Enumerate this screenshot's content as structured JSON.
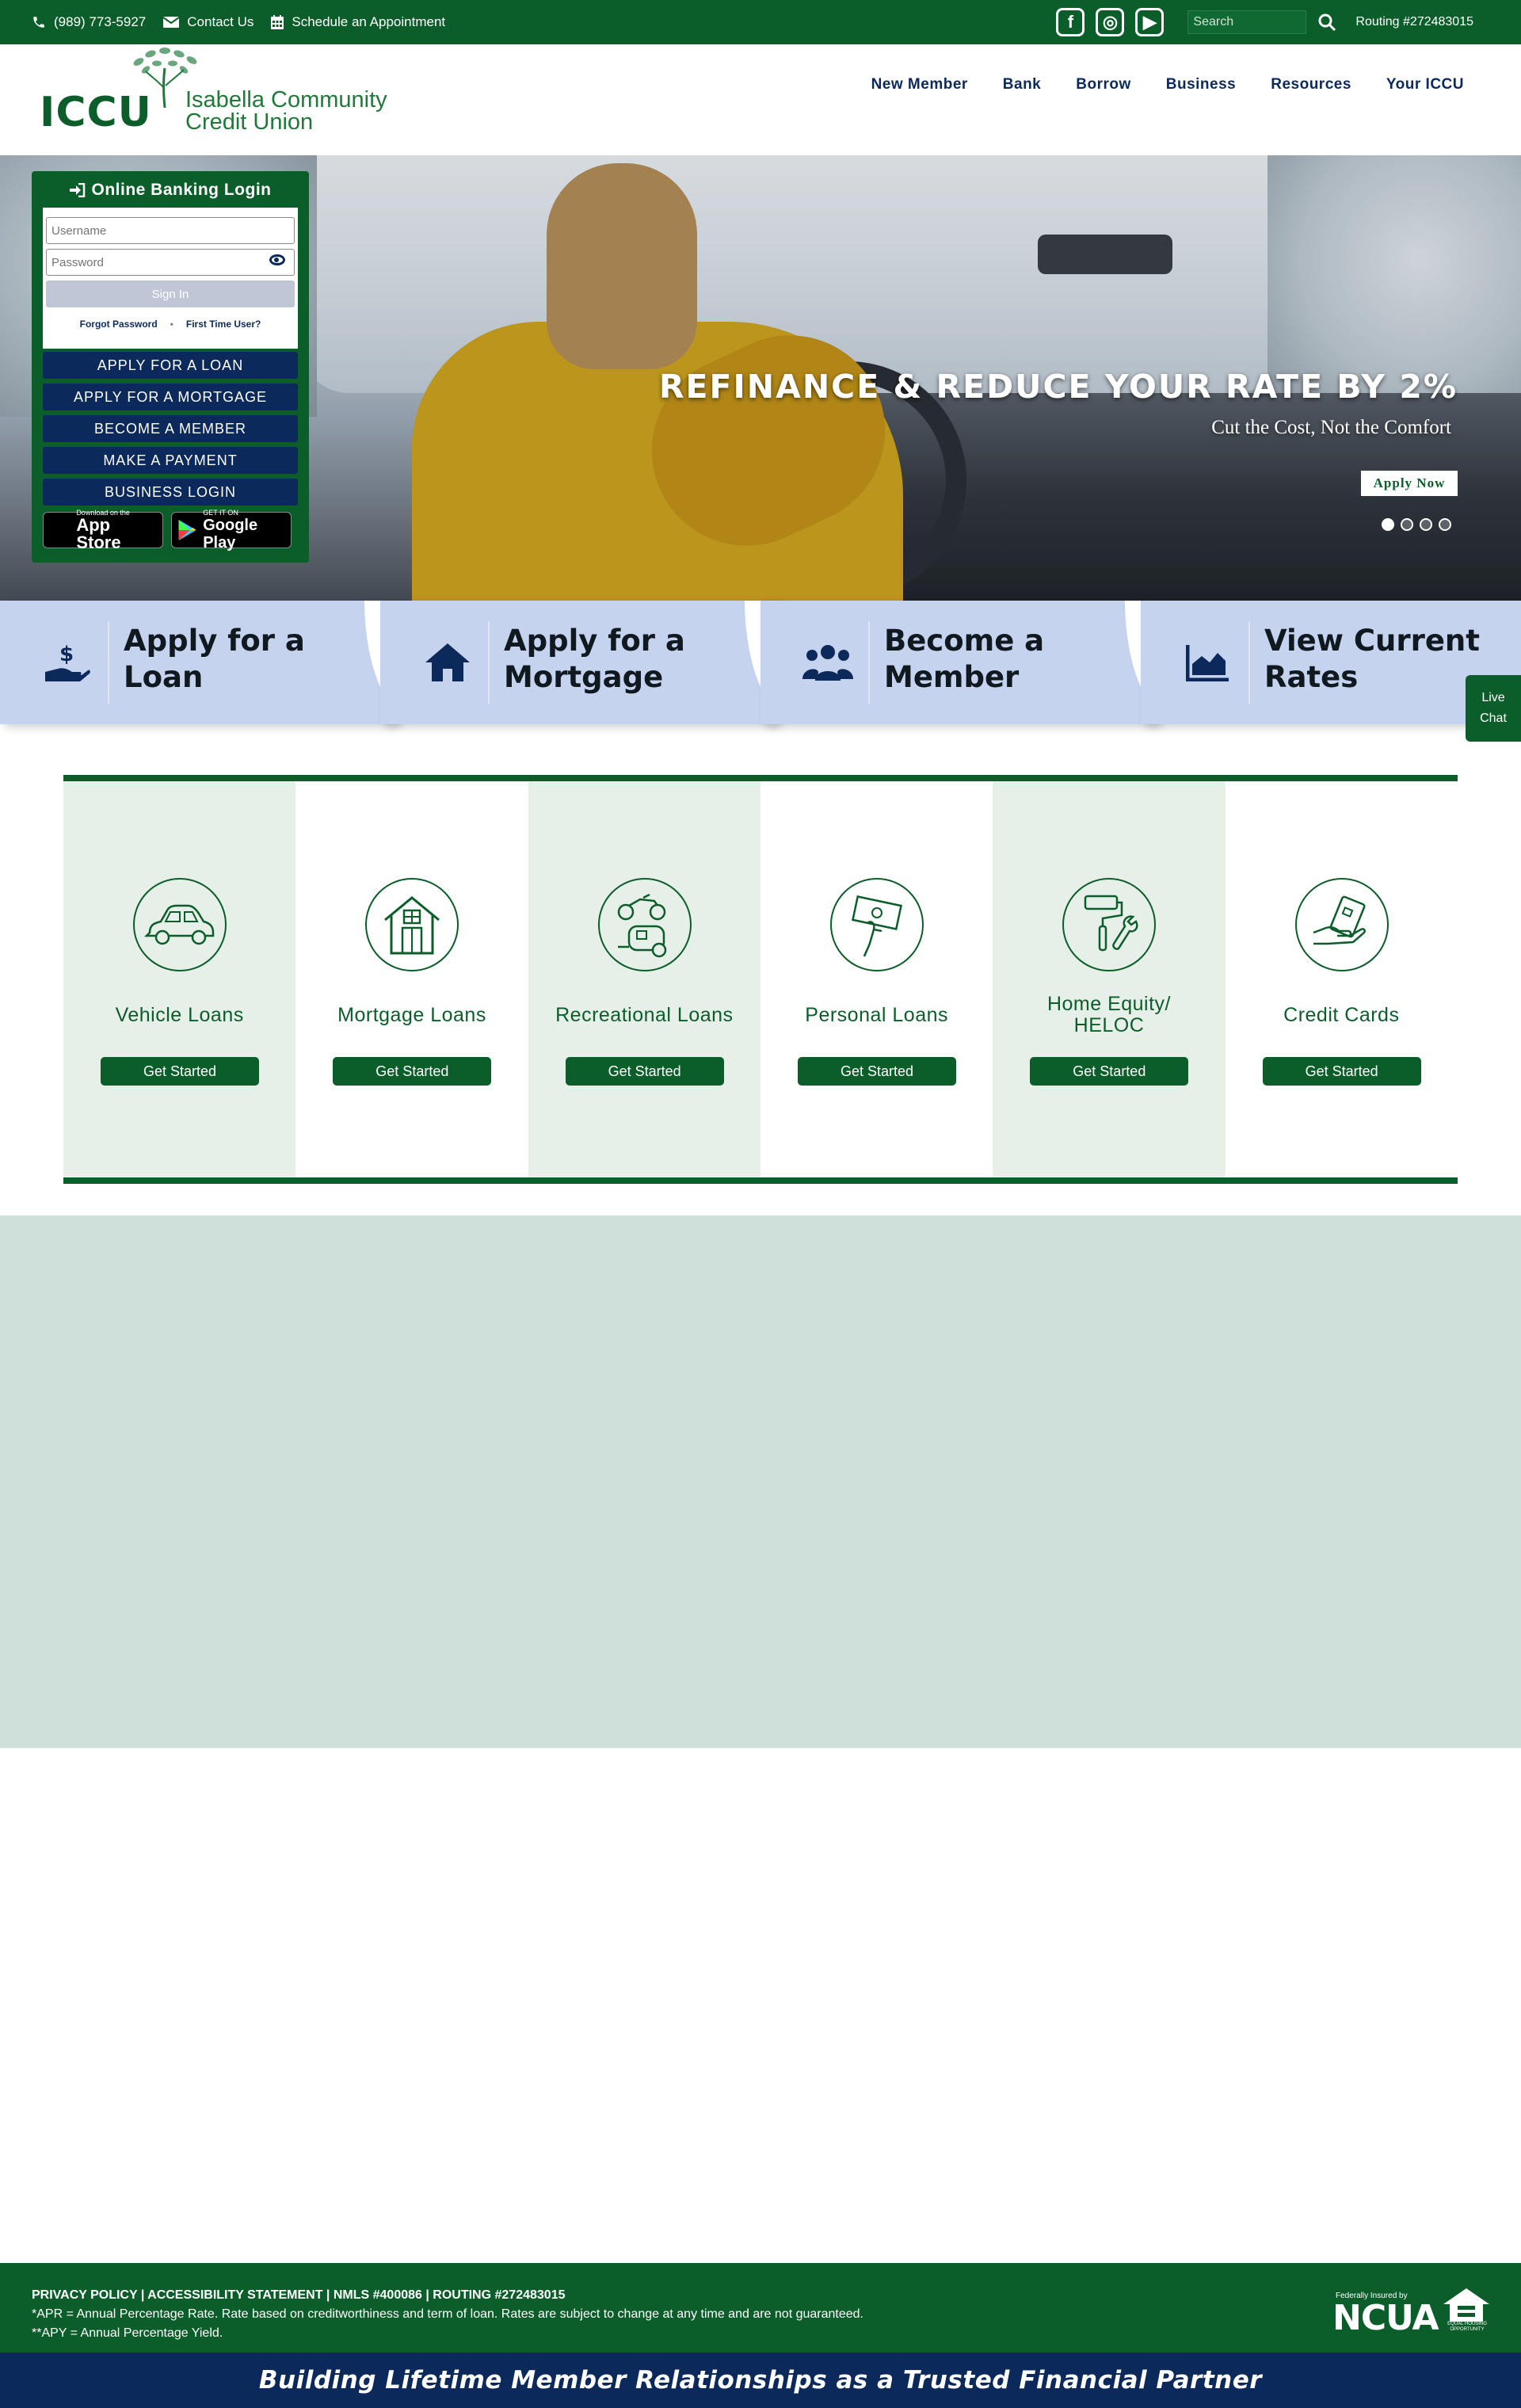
{
  "topbar": {
    "phone": "(989) 773-5927",
    "contact": "Contact Us",
    "schedule": "Schedule an Appointment",
    "social": {
      "facebook": "f",
      "instagram": "◎",
      "youtube": "▶"
    },
    "search_placeholder": "Search",
    "routing": "Routing #272483015"
  },
  "header": {
    "logo_text": "ICCU",
    "logo_name_line1": "Isabella Community",
    "logo_name_line2": "Credit Union",
    "nav": [
      "New Member",
      "Bank",
      "Borrow",
      "Business",
      "Resources",
      "Your ICCU"
    ]
  },
  "login": {
    "title": "Online Banking Login",
    "username_placeholder": "Username",
    "password_placeholder": "Password",
    "signin": "Sign In",
    "forgot": "Forgot Password",
    "first_time": "First Time User?",
    "quick_links": [
      "APPLY FOR A LOAN",
      "APPLY FOR A MORTGAGE",
      "BECOME A MEMBER",
      "MAKE A PAYMENT",
      "BUSINESS LOGIN"
    ],
    "app_store": {
      "small": "Download on the",
      "large": "App Store"
    },
    "google_play": {
      "small": "GET IT ON",
      "large": "Google Play"
    }
  },
  "hero": {
    "headline": "REFINANCE & REDUCE YOUR RATE BY 2%",
    "subhead": "Cut the Cost, Not the Comfort",
    "cta": "Apply Now",
    "slides": 4,
    "active_slide": 1
  },
  "cta_cards": [
    {
      "line1": "Apply for a",
      "line2": "Loan",
      "icon": "hand-dollar-icon"
    },
    {
      "line1": "Apply for a",
      "line2": "Mortgage",
      "icon": "house-icon"
    },
    {
      "line1": "Become a",
      "line2": "Member",
      "icon": "users-icon"
    },
    {
      "line1": "View Current",
      "line2": "Rates",
      "icon": "area-chart-icon"
    }
  ],
  "live_chat": {
    "line1": "Live",
    "line2": "Chat"
  },
  "loans": [
    {
      "title": "Vehicle Loans",
      "button": "Get Started",
      "icon": "car-icon"
    },
    {
      "title": "Mortgage Loans",
      "button": "Get Started",
      "icon": "house-icon"
    },
    {
      "title": "Recreational Loans",
      "button": "Get Started",
      "icon": "atv-camper-icon"
    },
    {
      "title": "Personal Loans",
      "button": "Get Started",
      "icon": "cash-hand-icon"
    },
    {
      "title": "Home Equity/ HELOC",
      "button": "Get Started",
      "icon": "roller-wrench-icon"
    },
    {
      "title": "Credit Cards",
      "button": "Get Started",
      "icon": "card-hand-icon"
    }
  ],
  "footer": {
    "links": "PRIVACY POLICY | ACCESSIBILITY STATEMENT | NMLS #400086 | ROUTING #272483015",
    "apr_note": "*APR = Annual Percentage Rate. Rate based on creditworthiness and term of loan. Rates are subject to change at any time and are not guaranteed.",
    "apy_note": "**APY = Annual Percentage Yield.",
    "ncua_small": "Federally Insured by",
    "ncua_big": "NCUA",
    "eho_label": "EQUAL HOUSING OPPORTUNITY"
  },
  "tagline": "Building Lifetime Member Relationships as a Trusted Financial Partner",
  "colors": {
    "primary_green": "#0b5e2a",
    "navy": "#0b2a5b",
    "cta_blue": "#c5d3ef",
    "band": "#cfe0da"
  }
}
